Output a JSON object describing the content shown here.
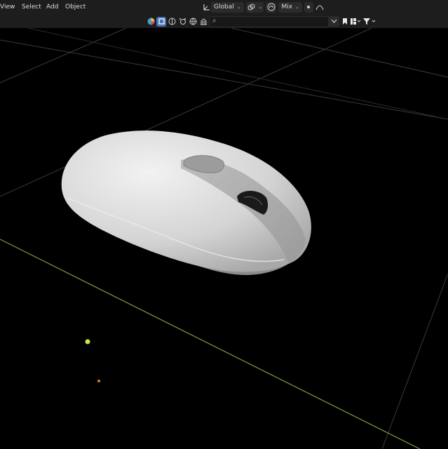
{
  "header": {
    "menu": [
      "View",
      "Select",
      "Add",
      "Object"
    ],
    "transform_orientation": "Global",
    "pivot_label": "Mix",
    "icons": [
      "transform-orientation-icon",
      "link-icon",
      "proportional-edit-icon",
      "snap-icon",
      "falloff-icon"
    ]
  },
  "outliner_toolbar": {
    "filter_icons": [
      "color-wheel-icon",
      "object-icon",
      "sphere-icon",
      "particles-icon",
      "world-icon",
      "scene-icon"
    ],
    "search_placeholder": "",
    "right_icons": [
      "collapse-icon",
      "bookmark-icon",
      "new-collection-icon",
      "filter-icon"
    ]
  },
  "viewport": {
    "background": "#000000",
    "grid_color": "#3a3a3a",
    "x_axis_color": "#7aa032",
    "object": "computer-mouse-model",
    "light_dot_color": "#d6e04a",
    "camera_dot_color": "#e07a1a"
  }
}
